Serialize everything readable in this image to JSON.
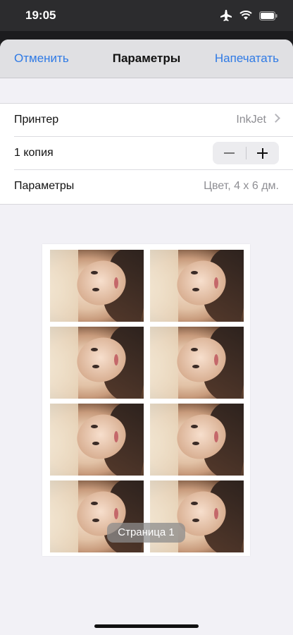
{
  "status": {
    "time": "19:05"
  },
  "nav": {
    "cancel": "Отменить",
    "title": "Параметры",
    "print": "Напечатать"
  },
  "settings": {
    "printer_label": "Принтер",
    "printer_value": "InkJet",
    "copies_label": "1 копия",
    "options_label": "Параметры",
    "options_value": "Цвет, 4 x 6 дм."
  },
  "preview": {
    "page_label": "Страница 1",
    "photo_count": 8
  }
}
